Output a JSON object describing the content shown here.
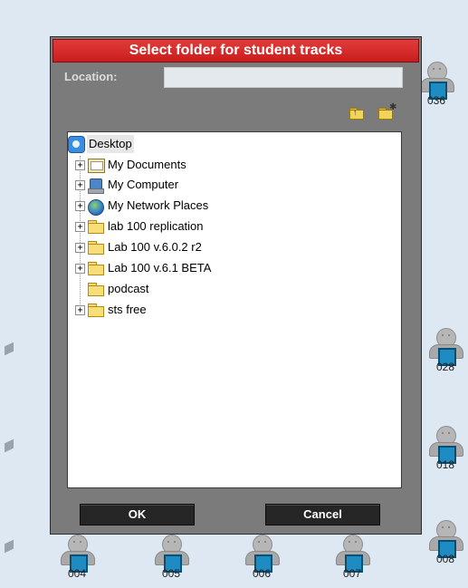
{
  "dialog": {
    "title": "Select folder for student tracks",
    "location_label": "Location:",
    "location_value": "",
    "tools": {
      "up_folder_icon": "folder-up-icon",
      "new_folder_icon": "new-folder-icon"
    },
    "tree": {
      "root": {
        "label": "Desktop",
        "icon": "desktop-icon"
      },
      "items": [
        {
          "label": "My Documents",
          "icon": "documents-icon",
          "expandable": true
        },
        {
          "label": "My Computer",
          "icon": "computer-icon",
          "expandable": true
        },
        {
          "label": "My Network Places",
          "icon": "network-icon",
          "expandable": true
        },
        {
          "label": "lab 100 replication",
          "icon": "folder-icon",
          "expandable": true
        },
        {
          "label": "Lab 100 v.6.0.2 r2",
          "icon": "folder-icon",
          "expandable": true
        },
        {
          "label": "Lab 100 v.6.1 BETA",
          "icon": "folder-icon",
          "expandable": true
        },
        {
          "label": "podcast",
          "icon": "folder-icon",
          "expandable": false
        },
        {
          "label": "sts free",
          "icon": "folder-icon",
          "expandable": true
        }
      ]
    },
    "ok_label": "OK",
    "cancel_label": "Cancel"
  },
  "stations": {
    "right": [
      "036",
      "028",
      "018",
      "008"
    ],
    "bottom": [
      "004",
      "005",
      "006",
      "007"
    ]
  },
  "colors": {
    "title_bar": "#d32626",
    "dialog_bg": "#7b7b7b",
    "button_bg": "#262626",
    "station_screen": "#1e8cc2"
  }
}
